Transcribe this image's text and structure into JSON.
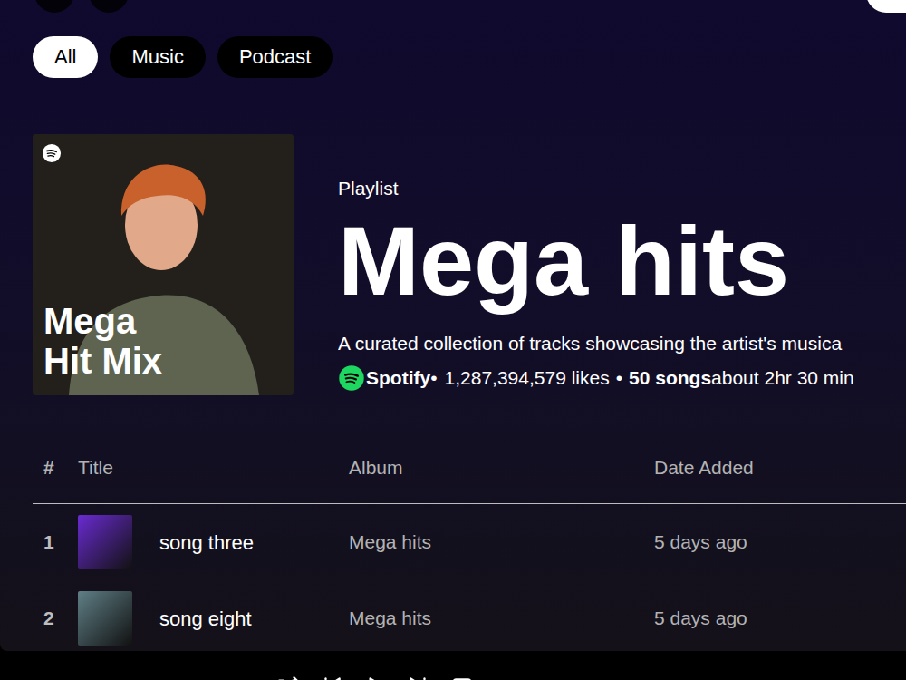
{
  "filters": [
    {
      "label": "All",
      "selected": true
    },
    {
      "label": "Music",
      "selected": false
    },
    {
      "label": "Podcast",
      "selected": false
    }
  ],
  "playlist": {
    "type": "Playlist",
    "title": "Mega hits",
    "cover_caption": "Mega Hit Mix",
    "description": "A curated collection of tracks showcasing the artist's musica",
    "owner": "Spotify",
    "separator": "•",
    "likes": "1,287,394,579 likes",
    "separator2": "•",
    "songs": "50 songs",
    "duration": "about 2hr 30 min"
  },
  "table": {
    "columns": [
      "#",
      "Title",
      "Album",
      "Date Added"
    ],
    "rows": [
      {
        "number": "1",
        "title": "song three",
        "album": "Mega hits",
        "added": "5 days ago",
        "color": "#6a2bd1"
      },
      {
        "number": "2",
        "title": "song eight",
        "album": "Mega hits",
        "added": "5 days ago",
        "color": "#5f7f86"
      }
    ]
  }
}
